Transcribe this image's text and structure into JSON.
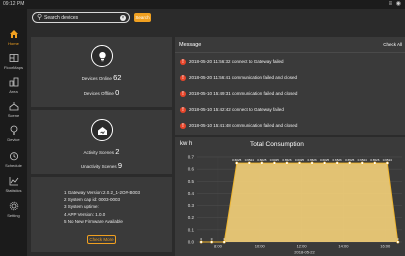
{
  "status_bar": {
    "time": "09:12 PM",
    "icons": "≡ ◉"
  },
  "sidebar": {
    "items": [
      {
        "label": "Home",
        "icon": "home-icon",
        "active": true
      },
      {
        "label": "FloorMaps",
        "icon": "floormaps-icon",
        "active": false
      },
      {
        "label": "Area",
        "icon": "area-icon",
        "active": false
      },
      {
        "label": "Scene",
        "icon": "scene-icon",
        "active": false
      },
      {
        "label": "Device",
        "icon": "device-icon",
        "active": false
      },
      {
        "label": "Schedule",
        "icon": "schedule-icon",
        "active": false
      },
      {
        "label": "Statistics",
        "icon": "statistics-icon",
        "active": false
      },
      {
        "label": "Setting",
        "icon": "setting-icon",
        "active": false
      }
    ]
  },
  "search": {
    "placeholder": "Search devices",
    "button_label": "Search"
  },
  "devices": {
    "online_label": "Devices Online",
    "online_count": "62",
    "offline_label": "Devices Offline",
    "offline_count": "0"
  },
  "scenes": {
    "activity_label": "Activity Scenes",
    "activity_count": "2",
    "unactivity_label": "Unactivity Scenes",
    "unactivity_count": "9"
  },
  "system": {
    "lines": [
      "1 Gateway Version:2.0.2_1-2O#-B003",
      "2 System cap id: 0003-0003",
      "3 System uptime:",
      "4 APP Version: 1.0.0",
      "5 No New Firmware Available"
    ],
    "check_button": "Check More"
  },
  "messages": {
    "title": "Message",
    "check_all": "Check All",
    "items": [
      "2018-05-20 11:56:32 connect to Gateway failed",
      "2018-05-20 11:56:41 communication failed and closed",
      "2018-05-10 15:49:31 communication failed and closed",
      "2018-05-10 15:42:42 connect to Gateway failed",
      "2018-05-10 15:41:48 communication failed and closed"
    ]
  },
  "colors": {
    "accent": "#f0a020",
    "alert": "#e8452a",
    "panel": "#3a3a3a",
    "background": "#2b2b2b"
  },
  "chart_data": {
    "type": "area",
    "title": "Total Consumption",
    "ylabel": "kw h",
    "xlabel": "2018-05-22",
    "ylim": [
      0,
      0.7
    ],
    "yticks": [
      "0.0",
      "0.1",
      "0.2",
      "0.3",
      "0.4",
      "0.5",
      "0.6",
      "0.7"
    ],
    "xticks": [
      {
        "x": 8.0,
        "label": "8:00"
      },
      {
        "x": 10.0,
        "label": "10:00"
      },
      {
        "x": 12.0,
        "label": "12:00"
      },
      {
        "x": 14.0,
        "label": "14:00"
      },
      {
        "x": 16.0,
        "label": "16:00"
      }
    ],
    "x": [
      7.2,
      7.7,
      8.3,
      8.9,
      9.5,
      10.1,
      10.7,
      11.3,
      11.9,
      12.5,
      13.1,
      13.7,
      14.3,
      14.9,
      15.5,
      16.1,
      16.6
    ],
    "values": [
      0,
      0,
      0,
      0.65,
      0.65,
      0.65,
      0.65,
      0.65,
      0.65,
      0.65,
      0.65,
      0.65,
      0.65,
      0.65,
      0.65,
      0.65,
      0
    ],
    "point_labels": [
      "0",
      "0",
      "0",
      "0.6025",
      "0.6524",
      "0.6025",
      "0.6025",
      "0.6526",
      "0.6025",
      "0.6526",
      "0.6025",
      "0.6526",
      "0.6525",
      "0.6524",
      "0.6526",
      "0.6524",
      "0"
    ],
    "grid": true,
    "fill_color": "#f5d27a",
    "line_color": "#f0b429"
  }
}
